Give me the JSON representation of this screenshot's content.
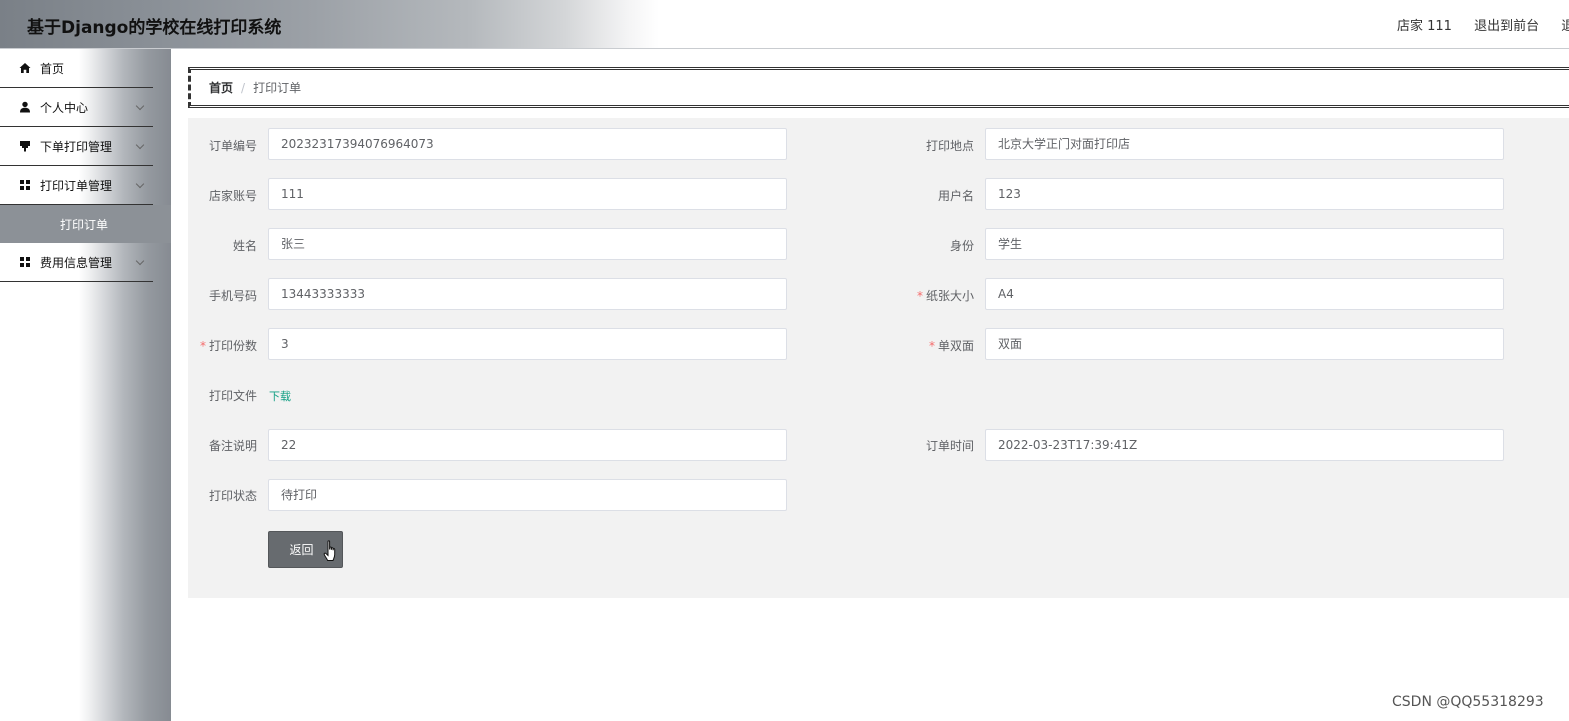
{
  "header": {
    "title": "基于Django的学校在线打印系统",
    "user_label": "店家 111",
    "back_front_label": "退出到前台",
    "logout_label": "退"
  },
  "sidebar": {
    "items": [
      {
        "label": "首页",
        "icon": "home-icon"
      },
      {
        "label": "个人中心",
        "icon": "user-icon"
      },
      {
        "label": "下单打印管理",
        "icon": "print-icon"
      },
      {
        "label": "打印订单管理",
        "icon": "grid-icon"
      },
      {
        "label": "打印订单",
        "icon": ""
      },
      {
        "label": "费用信息管理",
        "icon": "grid-icon"
      }
    ]
  },
  "breadcrumb": {
    "home": "首页",
    "separator": "/",
    "current": "打印订单"
  },
  "form": {
    "order_no": {
      "label": "订单编号",
      "value": "202323173940769640​73"
    },
    "print_location": {
      "label": "打印地点",
      "value": "北京大学正门对面打印店"
    },
    "shop_account": {
      "label": "店家账号",
      "value": "111"
    },
    "username": {
      "label": "用户名",
      "value": "123"
    },
    "name": {
      "label": "姓名",
      "value": "张三"
    },
    "identity": {
      "label": "身份",
      "value": "学生"
    },
    "phone": {
      "label": "手机号码",
      "value": "13443333333"
    },
    "paper_size": {
      "label": "纸张大小",
      "value": "A4"
    },
    "copies": {
      "label": "打印份数",
      "value": "3"
    },
    "duplex": {
      "label": "单双面",
      "value": "双面"
    },
    "print_file": {
      "label": "打印文件",
      "link": "下载"
    },
    "remark": {
      "label": "备注说明",
      "value": "22"
    },
    "order_time": {
      "label": "订单时间",
      "value": "2022-03-23T17:39:41Z"
    },
    "print_status": {
      "label": "打印状态",
      "value": "待打印"
    },
    "required_mark": "*",
    "back_button": "返回"
  },
  "watermark": "CSDN @QQ55318293",
  "colors": {
    "link": "#14a085",
    "required": "#f56c6c",
    "button": "#676b6f",
    "panel": "#f2f2f2"
  }
}
